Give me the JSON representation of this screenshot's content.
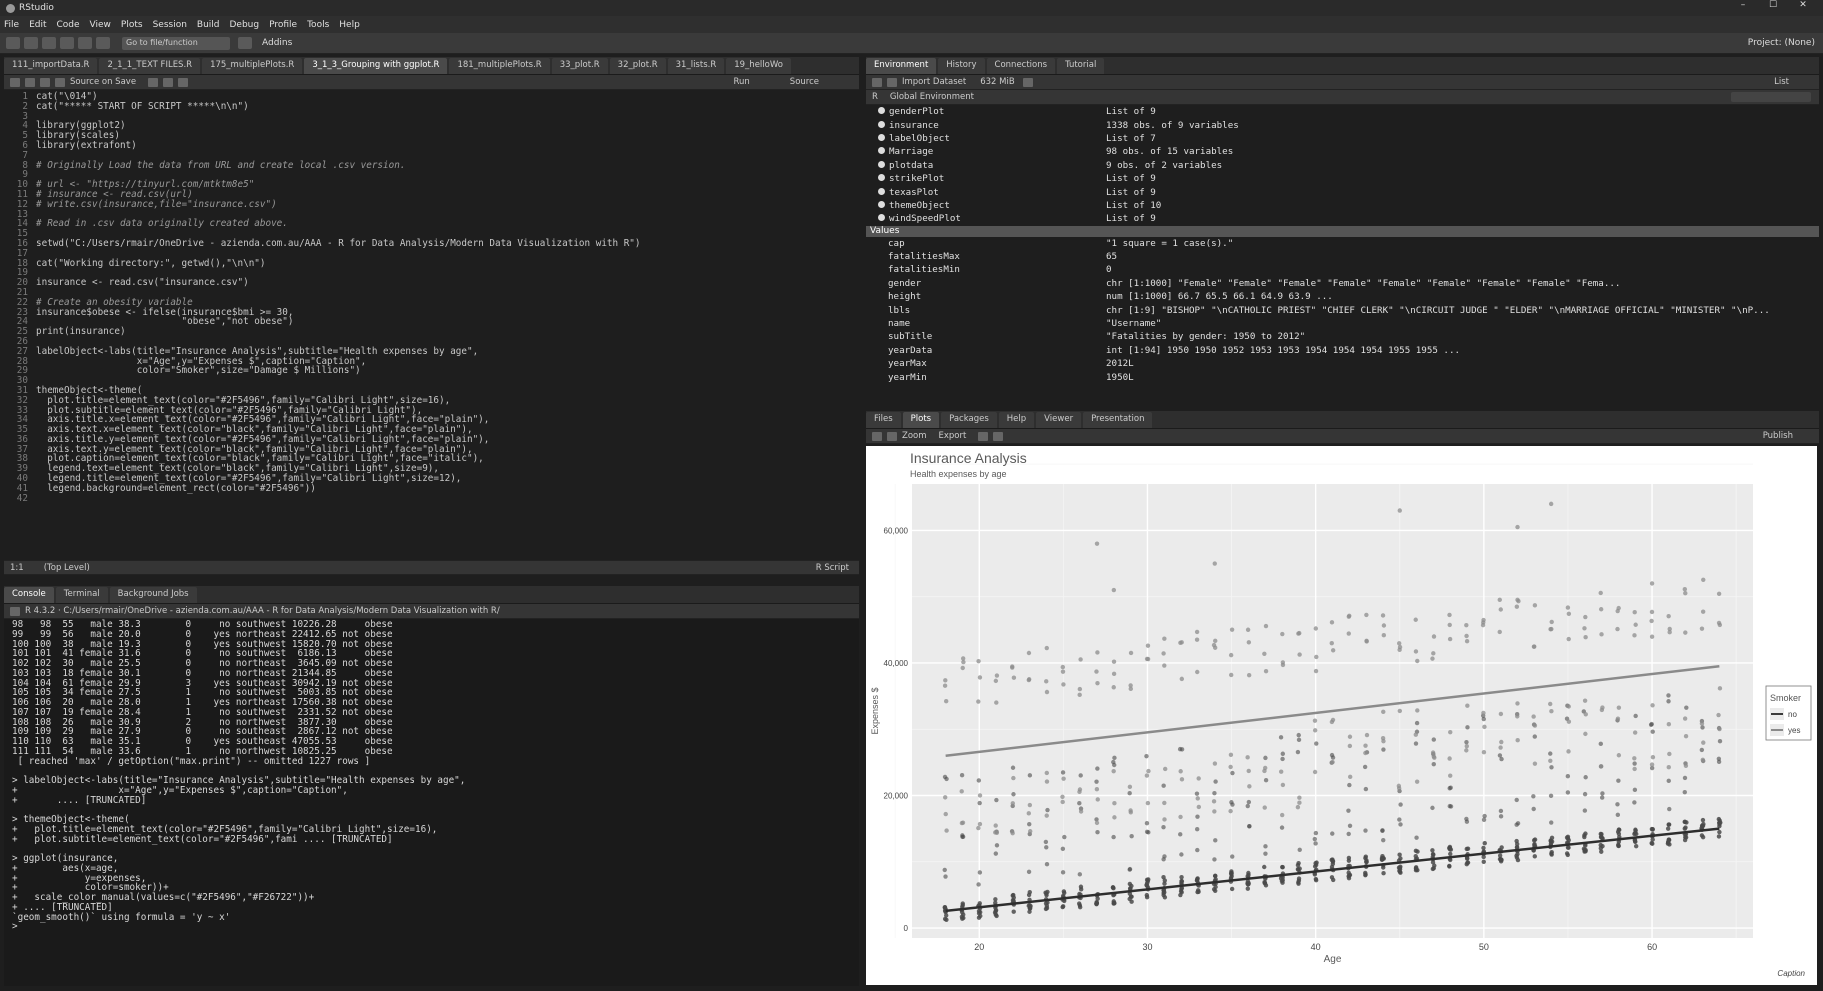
{
  "window": {
    "title": "RStudio",
    "controls": [
      "–",
      "☐",
      "✕"
    ]
  },
  "menu": [
    "File",
    "Edit",
    "Code",
    "View",
    "Plots",
    "Session",
    "Build",
    "Debug",
    "Profile",
    "Tools",
    "Help"
  ],
  "toolbar": {
    "goto": "Go to file/function",
    "addins": "Addins",
    "project": "Project: (None)"
  },
  "editor": {
    "tabs": [
      "111_importData.R",
      "2_1_1_TEXT FILES.R",
      "175_multiplePlots.R",
      "3_1_3_Grouping with ggplot.R",
      "181_multiplePlots.R",
      "33_plot.R",
      "32_plot.R",
      "31_lists.R",
      "19_helloWo"
    ],
    "source_on_save": "Source on Save",
    "run": "Run",
    "source": "Source",
    "lines": [
      "cat(\"\\014\")",
      "cat(\"***** START OF SCRIPT *****\\n\\n\")",
      "",
      "library(ggplot2)",
      "library(scales)",
      "library(extrafont)",
      "",
      "# Originally Load the data from URL and create local .csv version.",
      "",
      "# url <- \"https://tinyurl.com/mtktm8e5\"",
      "# insurance <- read.csv(url)",
      "# write.csv(insurance,file=\"insurance.csv\")",
      "",
      "# Read in .csv data originally created above.",
      "",
      "setwd(\"C:/Users/rmair/OneDrive - azienda.com.au/AAA - R for Data Analysis/Modern Data Visualization with R\")",
      "",
      "cat(\"Working directory:\", getwd(),\"\\n\\n\")",
      "",
      "insurance <- read.csv(\"insurance.csv\")",
      "",
      "# Create an obesity variable",
      "insurance$obese <- ifelse(insurance$bmi >= 30,",
      "                          \"obese\",\"not obese\")",
      "print(insurance)",
      "",
      "labelObject<-labs(title=\"Insurance Analysis\",subtitle=\"Health expenses by age\",",
      "                  x=\"Age\",y=\"Expenses $\",caption=\"Caption\",",
      "                  color=\"Smoker\",size=\"Damage $ Millions\")",
      "",
      "themeObject<-theme(",
      "  plot.title=element_text(color=\"#2F5496\",family=\"Calibri Light\",size=16),",
      "  plot.subtitle=element_text(color=\"#2F5496\",family=\"Calibri Light\"),",
      "  axis.title.x=element_text(color=\"#2F5496\",family=\"Calibri Light\",face=\"plain\"),",
      "  axis.text.x=element_text(color=\"black\",family=\"Calibri Light\",face=\"plain\"),",
      "  axis.title.y=element_text(color=\"#2F5496\",family=\"Calibri Light\",face=\"plain\"),",
      "  axis.text.y=element_text(color=\"black\",family=\"Calibri Light\",face=\"plain\"),",
      "  plot.caption=element_text(color=\"black\",family=\"Calibri Light\",face=\"italic\"),",
      "  legend.text=element_text(color=\"black\",family=\"Calibri Light\",size=9),",
      "  legend.title=element_text(color=\"#2F5496\",family=\"Calibri Light\",size=12),",
      "  legend.background=element_rect(color=\"#2F5496\"))",
      ""
    ],
    "status_pos": "1:1",
    "status_scope": "(Top Level)",
    "status_type": "R Script"
  },
  "console": {
    "tabs": [
      "Console",
      "Terminal",
      "Background Jobs"
    ],
    "path": "R 4.3.2 · C:/Users/rmair/OneDrive - azienda.com.au/AAA - R for Data Analysis/Modern Data Visualization with R/",
    "lines": [
      "98   98  55   male 38.3        0     no southwest 10226.28     obese",
      "99   99  56   male 20.0        0    yes northeast 22412.65 not obese",
      "100 100  38   male 19.3        0    yes southwest 15820.70 not obese",
      "101 101  41 female 31.6        0     no southwest  6186.13     obese",
      "102 102  30   male 25.5        0     no northeast  3645.09 not obese",
      "103 103  18 female 30.1        0     no northeast 21344.85     obese",
      "104 104  61 female 29.9        3    yes southeast 30942.19 not obese",
      "105 105  34 female 27.5        1     no southwest  5003.85 not obese",
      "106 106  20   male 28.0        1    yes northeast 17560.38 not obese",
      "107 107  19 female 28.4        1     no southwest  2331.52 not obese",
      "108 108  26   male 30.9        2     no northwest  3877.30     obese",
      "109 109  29   male 27.9        0     no southeast  2867.12 not obese",
      "110 110  63   male 35.1        0    yes southeast 47055.53     obese",
      "111 111  54   male 33.6        1     no northwest 10825.25     obese",
      " [ reached 'max' / getOption(\"max.print\") -- omitted 1227 rows ]",
      "",
      "> labelObject<-labs(title=\"Insurance Analysis\",subtitle=\"Health expenses by age\",",
      "+                  x=\"Age\",y=\"Expenses $\",caption=\"Caption\",",
      "+       .... [TRUNCATED]",
      "",
      "> themeObject<-theme(",
      "+   plot.title=element_text(color=\"#2F5496\",family=\"Calibri Light\",size=16),",
      "+   plot.subtitle=element_text(color=\"#2F5496\",fami .... [TRUNCATED]",
      "",
      "> ggplot(insurance,",
      "+        aes(x=age,",
      "+            y=expenses,",
      "+            color=smoker))+",
      "+   scale_color_manual(values=c(\"#2F5496\",\"#F26722\"))+",
      "+ .... [TRUNCATED]",
      "`geom_smooth()` using formula = 'y ~ x'",
      ">"
    ]
  },
  "environment": {
    "tabs": [
      "Environment",
      "History",
      "Connections",
      "Tutorial"
    ],
    "import": "Import Dataset",
    "mem": "632 MiB",
    "list": "List",
    "lang": "R",
    "scope": "Global Environment",
    "data_rows": [
      {
        "name": "genderPlot",
        "value": "List of 9"
      },
      {
        "name": "insurance",
        "value": "1338 obs. of 9 variables"
      },
      {
        "name": "labelObject",
        "value": "List of 7"
      },
      {
        "name": "Marriage",
        "value": "98 obs. of 15 variables"
      },
      {
        "name": "plotdata",
        "value": "9 obs. of 2 variables"
      },
      {
        "name": "strikePlot",
        "value": "List of 9"
      },
      {
        "name": "texasPlot",
        "value": "List of 9"
      },
      {
        "name": "themeObject",
        "value": "List of 10"
      },
      {
        "name": "windSpeedPlot",
        "value": "List of 9"
      }
    ],
    "values_header": "Values",
    "value_rows": [
      {
        "name": "cap",
        "value": "\"1 square = 1 case(s).\""
      },
      {
        "name": "fatalitiesMax",
        "value": "65"
      },
      {
        "name": "fatalitiesMin",
        "value": "0"
      },
      {
        "name": "gender",
        "value": "chr [1:1000] \"Female\" \"Female\" \"Female\" \"Female\" \"Female\" \"Female\" \"Female\" \"Female\" \"Fema..."
      },
      {
        "name": "height",
        "value": "num [1:1000] 66.7 65.5 66.1 64.9 63.9 ..."
      },
      {
        "name": "lbls",
        "value": "chr [1:9] \"BISHOP\" \"\\nCATHOLIC PRIEST\" \"CHIEF CLERK\" \"\\nCIRCUIT JUDGE \" \"ELDER\" \"\\nMARRIAGE OFFICIAL\" \"MINISTER\" \"\\nP..."
      },
      {
        "name": "name",
        "value": "\"Username\""
      },
      {
        "name": "subTitle",
        "value": "\"Fatalities by gender: 1950 to 2012\""
      },
      {
        "name": "yearData",
        "value": "int [1:94] 1950 1950 1952 1953 1953 1954 1954 1954 1955 1955 ..."
      },
      {
        "name": "yearMax",
        "value": "2012L"
      },
      {
        "name": "yearMin",
        "value": "1950L"
      }
    ]
  },
  "files": {
    "tabs": [
      "Files",
      "Plots",
      "Packages",
      "Help",
      "Viewer",
      "Presentation"
    ],
    "zoom": "Zoom",
    "export": "Export",
    "publish": "Publish"
  },
  "chart_data": {
    "type": "scatter",
    "title": "Insurance Analysis",
    "subtitle": "Health expenses by age",
    "xlabel": "Age",
    "ylabel": "Expenses $",
    "caption": "Caption",
    "xlim": [
      16,
      66
    ],
    "ylim": [
      -1500,
      67000
    ],
    "xticks": [
      20,
      30,
      40,
      50,
      60
    ],
    "xtick_labels": [
      "20",
      "30",
      "40",
      "50",
      "60"
    ],
    "yticks": [
      0,
      20000,
      40000,
      60000
    ],
    "ytick_labels": [
      "0",
      "20,000",
      "40,000",
      "60,000"
    ],
    "legend": {
      "title": "Smoker",
      "position": "right",
      "items": [
        {
          "label": "no",
          "color": "#3a3a3a"
        },
        {
          "label": "yes",
          "color": "#8a8a8a"
        }
      ]
    },
    "series": [
      {
        "name": "no",
        "color": "#4a4a4a",
        "trend": [
          [
            18,
            2600
          ],
          [
            64,
            15000
          ]
        ]
      },
      {
        "name": "yes",
        "color": "#8c8c8c",
        "trend": [
          [
            18,
            26000
          ],
          [
            64,
            39500
          ]
        ]
      }
    ]
  }
}
